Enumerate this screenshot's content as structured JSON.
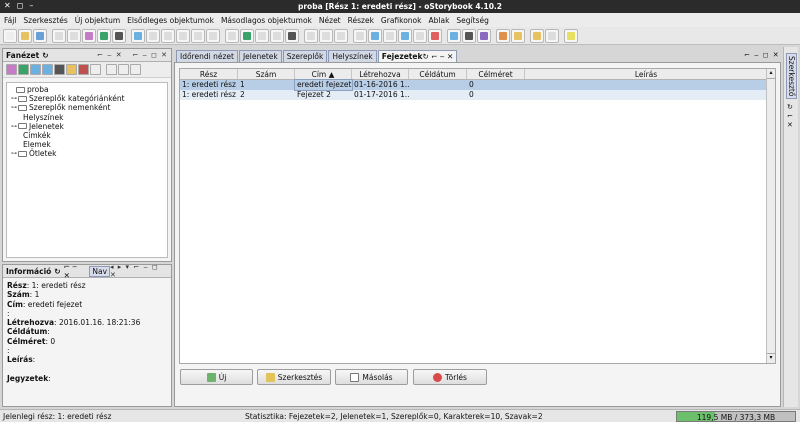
{
  "window": {
    "title": "proba [Rész 1: eredeti rész] - oStorybook 4.10.2",
    "controls": [
      "✕",
      "◻",
      "–"
    ]
  },
  "menu": [
    "Fájl",
    "Szerkesztés",
    "Új objektum",
    "Elsődleges objektumok",
    "Másodlagos objektumok",
    "Nézet",
    "Részek",
    "Grafikonok",
    "Ablak",
    "Segítség"
  ],
  "toolbar": {
    "button_count": 36
  },
  "left_panel": {
    "title": "Fanézet",
    "tree": [
      {
        "label": "proba",
        "level": 0,
        "expander": "",
        "folder": true
      },
      {
        "label": "Szereplők kategóriánként",
        "level": 1,
        "expander": "⊶",
        "folder": true
      },
      {
        "label": "Szereplők nemenként",
        "level": 1,
        "expander": "⊶",
        "folder": true
      },
      {
        "label": "Helyszínek",
        "level": 1,
        "expander": "",
        "folder": false
      },
      {
        "label": "Jelenetek",
        "level": 1,
        "expander": "⊶",
        "folder": true
      },
      {
        "label": "Címkék",
        "level": 1,
        "expander": "",
        "folder": false
      },
      {
        "label": "Elemek",
        "level": 1,
        "expander": "",
        "folder": false
      },
      {
        "label": "Ötletek",
        "level": 1,
        "expander": "⊶",
        "folder": true
      }
    ]
  },
  "info_panel": {
    "title": "Információ",
    "tab2": "Nav",
    "lines": [
      {
        "label": "Rész",
        "value": ": 1: eredeti rész"
      },
      {
        "label": "Szám",
        "value": ": 1"
      },
      {
        "label": "Cím",
        "value": ": eredeti fejezet"
      },
      {
        "label": "",
        "value": ":"
      },
      {
        "label": "Létrehozva",
        "value": ": 2016.01.16. 18:21:36"
      },
      {
        "label": "Céldátum",
        "value": ":"
      },
      {
        "label": "Célméret",
        "value": ": 0"
      },
      {
        "label": "",
        "value": ":"
      },
      {
        "label": "Leírás",
        "value": ":"
      },
      {
        "label": "",
        "value": ""
      },
      {
        "label": "Jegyzetek",
        "value": ":"
      }
    ]
  },
  "tabs": [
    "Időrendi nézet",
    "Jelenetek",
    "Szereplők",
    "Helyszínek",
    "Fejezetek"
  ],
  "active_tab": 4,
  "table": {
    "columns": [
      "Rész",
      "Szám",
      "Cím ▲",
      "Létrehozva",
      "Céldátum",
      "Célméret",
      "Leírás"
    ],
    "rows": [
      [
        "1: eredeti rész",
        "1",
        "eredeti fejezet",
        "01-16-2016 1...",
        "",
        "0",
        ""
      ],
      [
        "1: eredeti rész",
        "2",
        "Fejezet 2",
        "01-17-2016 1...",
        "",
        "0",
        ""
      ]
    ]
  },
  "buttons": {
    "new": "Új",
    "edit": "Szerkesztés",
    "copy": "Másolás",
    "delete": "Törlés"
  },
  "right_strip": {
    "label": "Szerkesztő"
  },
  "status": {
    "current_part": "Jelenlegi rész: 1: eredeti rész",
    "stats": "Statisztika: Fejezetek=2, Jelenetek=1, Szereplők=0, Karakterek=10, Szavak=2",
    "memory": "119,5 MB / 373,3 MB",
    "memory_used_fraction": 0.32,
    "memory_color": "#6cc06c"
  },
  "colors": {
    "accent_tab": "#d2d8e4",
    "selection": "#b8cde6"
  }
}
